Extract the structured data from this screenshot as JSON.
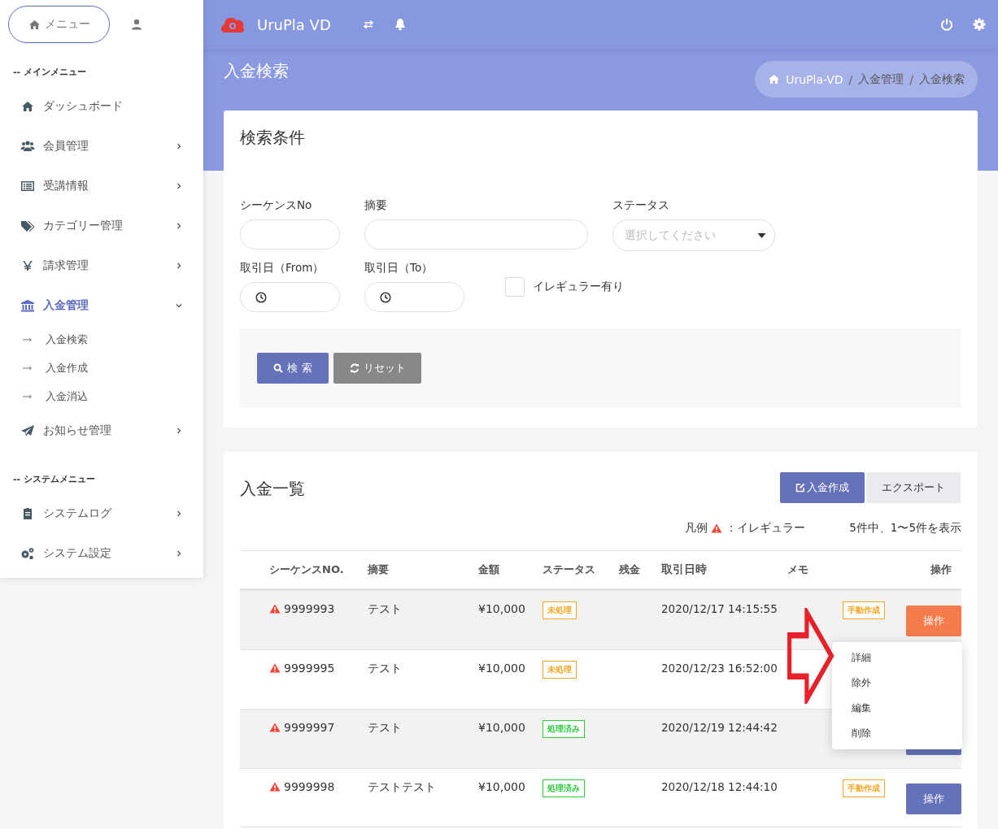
{
  "sidebar": {
    "menu_button": "メニュー",
    "sections": [
      {
        "title": "-- メインメニュー",
        "items": [
          {
            "label": "ダッシュボード",
            "kind": "link",
            "selected": false
          },
          {
            "label": "会員管理",
            "kind": "group",
            "expanded": false,
            "selected": false
          },
          {
            "label": "受講情報",
            "kind": "group",
            "expanded": false,
            "selected": false
          },
          {
            "label": "カテゴリー管理",
            "kind": "group",
            "expanded": false,
            "selected": false
          },
          {
            "label": "請求管理",
            "kind": "group",
            "expanded": false,
            "selected": false
          },
          {
            "label": "入金管理",
            "kind": "group",
            "expanded": true,
            "selected": true,
            "children": [
              {
                "label": "入金検索"
              },
              {
                "label": "入金作成"
              },
              {
                "label": "入金消込"
              }
            ]
          },
          {
            "label": "お知らせ管理",
            "kind": "group",
            "expanded": false,
            "selected": false
          }
        ]
      },
      {
        "title": "-- システムメニュー",
        "items": [
          {
            "label": "システムログ",
            "kind": "group",
            "expanded": false,
            "selected": false
          },
          {
            "label": "システム設定",
            "kind": "group",
            "expanded": false,
            "selected": false
          }
        ]
      }
    ]
  },
  "header": {
    "brand": "UruPla VD"
  },
  "page": {
    "title": "入金検索",
    "breadcrumb": {
      "separator": "/",
      "items": [
        "UruPla-VD",
        "入金管理",
        "入金検索"
      ]
    }
  },
  "search": {
    "title": "検索条件",
    "fields": [
      {
        "label": "シーケンスNo",
        "kind": "text"
      },
      {
        "label": "摘要",
        "kind": "text"
      },
      {
        "label": "ステータス",
        "kind": "select",
        "placeholder": "選択してください"
      },
      {
        "label": "取引日（From）",
        "kind": "date"
      },
      {
        "label": "取引日（To）",
        "kind": "date"
      }
    ],
    "checkbox": {
      "label": "イレギュラー有り",
      "checked": false
    },
    "buttons": [
      {
        "label": "検 索",
        "kind": "search"
      },
      {
        "label": "リセット",
        "kind": "reset"
      }
    ]
  },
  "list": {
    "title": "入金一覧",
    "buttons": [
      {
        "label": "入金作成",
        "kind": "create"
      },
      {
        "label": "エクスポート",
        "kind": "export"
      }
    ],
    "legend": {
      "prefix": "凡例",
      "suffix": "：イレギュラー"
    },
    "count": "5件中、1〜5件を表示",
    "columns": [
      "シーケンスNO.",
      "摘要",
      "金額",
      "ステータス",
      "残金",
      "取引日時",
      "メモ",
      "操作"
    ],
    "rows": [
      {
        "irregular": true,
        "seq": "9999993",
        "summary": "テスト",
        "amount": "¥10,000",
        "status": {
          "label": "未処理",
          "kind": "pending"
        },
        "date": "2020/12/17 14:15:55",
        "memo": "手動作成",
        "op": {
          "label": "操作",
          "selected": true
        }
      },
      {
        "irregular": true,
        "seq": "9999995",
        "summary": "テスト",
        "amount": "¥10,000",
        "status": {
          "label": "未処理",
          "kind": "pending"
        },
        "date": "2020/12/23 16:52:00"
      },
      {
        "irregular": true,
        "seq": "9999997",
        "summary": "テスト",
        "amount": "¥10,000",
        "status": {
          "label": "処理済み",
          "kind": "done"
        },
        "date": "2020/12/19 12:44:42",
        "op": {
          "selected": false
        }
      },
      {
        "irregular": true,
        "seq": "9999998",
        "summary": "テストテスト",
        "amount": "¥10,000",
        "status": {
          "label": "処理済み",
          "kind": "done"
        },
        "date": "2020/12/18 12:44:10",
        "memo": "手動作成",
        "op": {
          "label": "操作",
          "selected": false
        }
      }
    ],
    "menu": [
      "詳細",
      "除外",
      "編集",
      "削除"
    ]
  }
}
